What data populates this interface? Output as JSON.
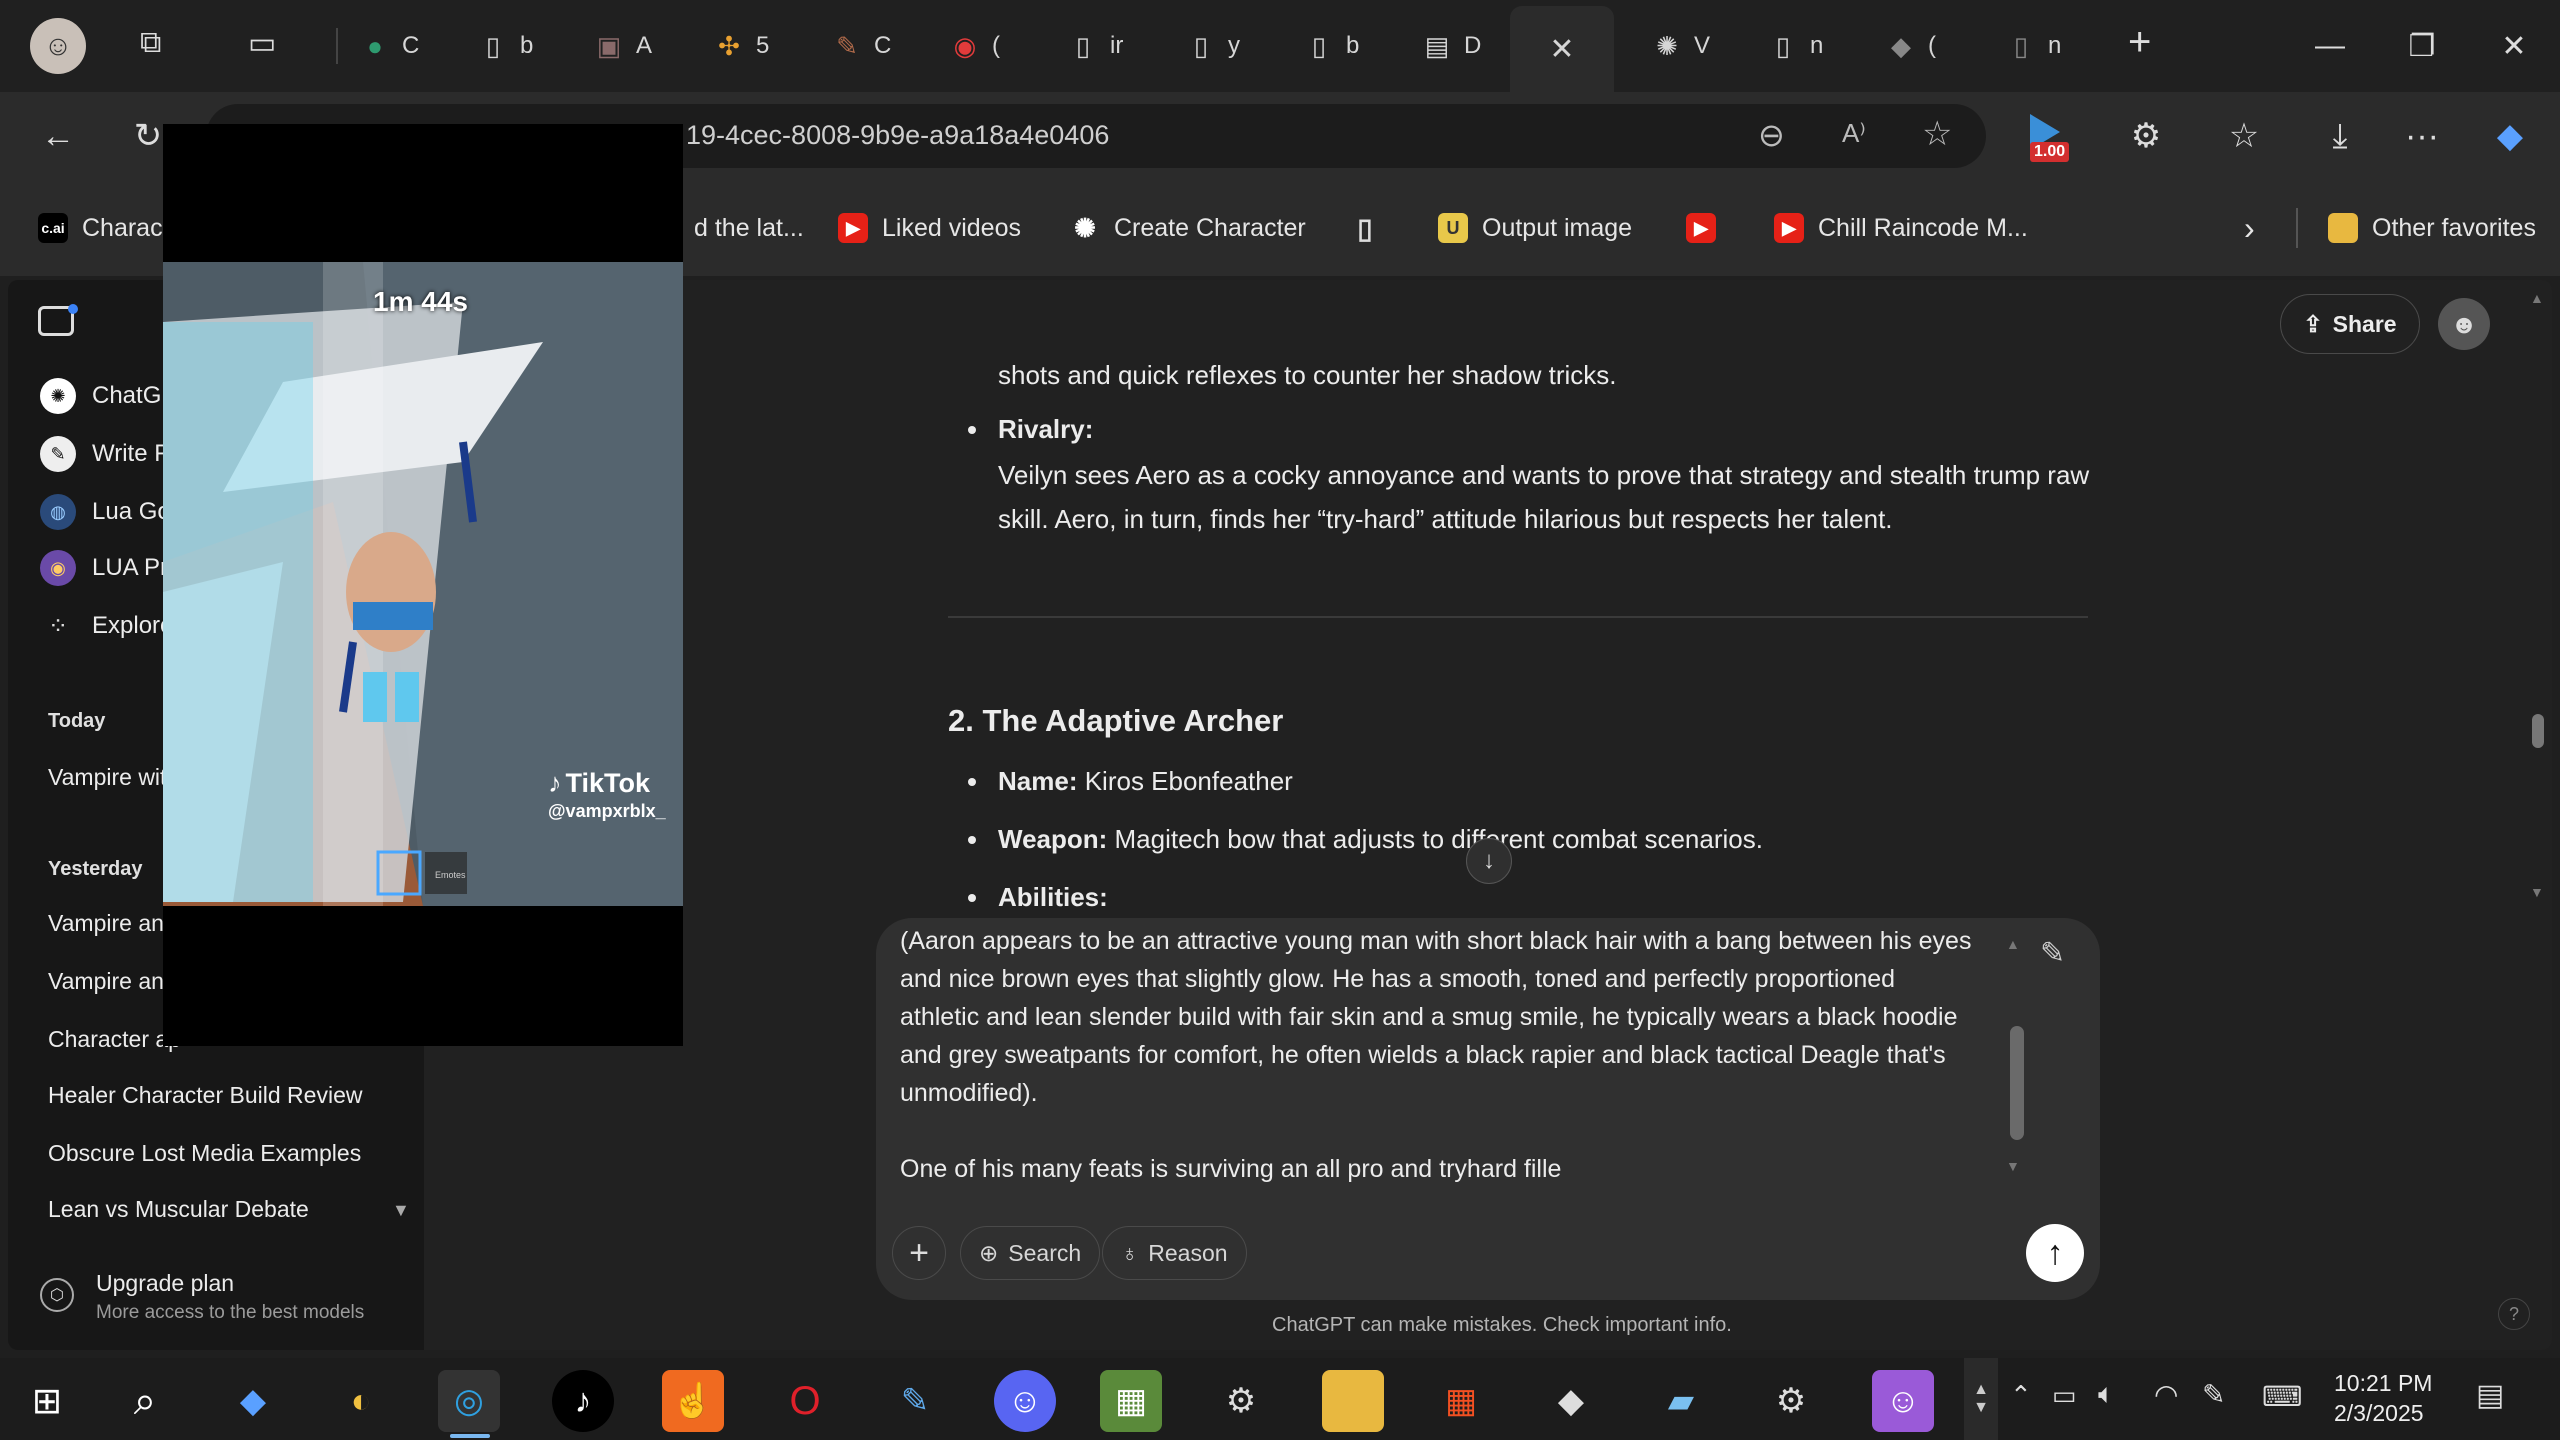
{
  "browser": {
    "tabs": [
      {
        "icon": "app-icon",
        "label": "C"
      },
      {
        "icon": "page-icon",
        "label": "b"
      },
      {
        "icon": "image-icon",
        "label": "A"
      },
      {
        "icon": "pinwheel-icon",
        "label": "5"
      },
      {
        "icon": "brush-icon",
        "label": "C"
      },
      {
        "icon": "video-icon",
        "label": "("
      },
      {
        "icon": "page-icon",
        "label": "ir"
      },
      {
        "icon": "page-icon",
        "label": "y"
      },
      {
        "icon": "page-icon",
        "label": "b"
      },
      {
        "icon": "game-icon",
        "label": "D"
      },
      {
        "icon": "openai-icon",
        "label": "V"
      },
      {
        "icon": "page-icon",
        "label": "n"
      },
      {
        "icon": "roblox-icon",
        "label": "("
      },
      {
        "icon": "page-icon",
        "label": "n"
      }
    ],
    "url_fragment": "19-4cec-8008-9b9e-a9a18a4e0406",
    "extension_badge": "1.00",
    "bookmarks": {
      "b0": "Charact",
      "b1": "d the lat...",
      "b2": "Liked videos",
      "b3": "Create Character",
      "b4": "Output image",
      "b5": "Chill Raincode M...",
      "other": "Other favorites"
    }
  },
  "sidebar": {
    "gpts": {
      "g0": "ChatGP",
      "g1": "Write F",
      "g2": "Lua Go",
      "g3": "LUA Pr",
      "g4": "Explore"
    },
    "today_label": "Today",
    "today": {
      "c0": "Vampire with"
    },
    "yesterday_label": "Yesterday",
    "yesterday": {
      "c0": "Vampire and",
      "c1": "Vampire and",
      "c2": "Character ap",
      "c3": "Healer Character Build Review",
      "c4": "Obscure Lost Media Examples",
      "c5": "Lean vs Muscular Debate"
    },
    "upgrade_title": "Upgrade plan",
    "upgrade_sub": "More access to the best models"
  },
  "header": {
    "share_label": "Share"
  },
  "conversation": {
    "line_cut": "shots and quick reflexes to counter her shadow tricks.",
    "rivalry_label": "Rivalry:",
    "rivalry_text_1": "Veilyn sees Aero as a cocky annoyance and wants to prove that strategy and stealth trump raw",
    "rivalry_text_2": "skill. Aero, in turn, finds her “try-hard” attitude hilarious but respects her talent.",
    "section_heading": "2. The Adaptive Archer",
    "name_label": "Name:",
    "name_value": " Kiros Ebonfeather",
    "weapon_label": "Weapon:",
    "weapon_value": " Magitech bow that adjusts to different combat scenarios.",
    "abilities_label": "Abilities:"
  },
  "composer": {
    "lines": {
      "l0": "(Aaron appears to be an attractive young man with short black hair with a bang between his eyes",
      "l1": "and nice brown eyes that slightly glow. He has a smooth, toned and perfectly proportioned",
      "l2": "athletic and lean slender build with fair skin and a smug smile, he typically wears a black hoodie",
      "l3": "and grey sweatpants for comfort, he often wields a black rapier and black tactical Deagle that's",
      "l4": "unmodified).",
      "l5": "",
      "l6": "One of his many feats is surviving an all pro and tryhard fille"
    },
    "search_label": "Search",
    "reason_label": "Reason"
  },
  "footer_note": "ChatGPT can make mistakes. Check important info.",
  "help_label": "?",
  "pip": {
    "timer": "1m 44s",
    "brand": "TikTok",
    "handle": "@vampxrblx_",
    "emote_label": "Emotes"
  },
  "taskbar": {
    "time": "10:21 PM",
    "date": "2/3/2025"
  },
  "colors": {
    "accent": "#2b2b2b",
    "sidebar_bg": "#171717",
    "chat_bg": "#212121",
    "composer_bg": "#303030"
  }
}
